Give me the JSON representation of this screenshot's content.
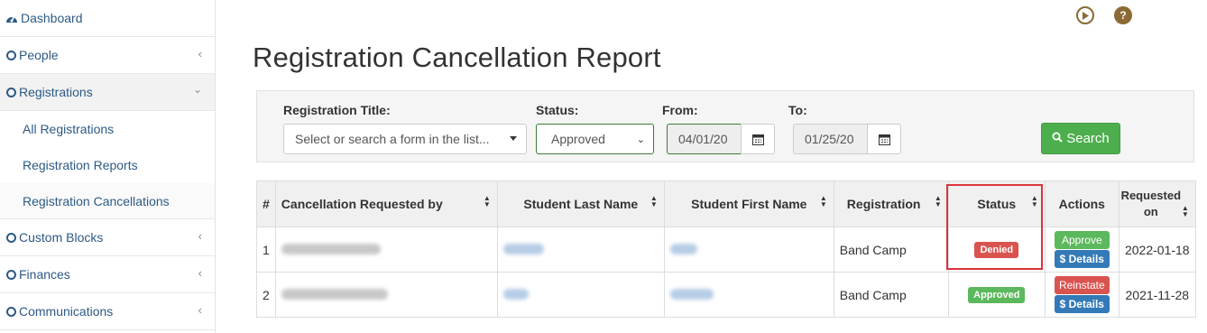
{
  "sidebar": {
    "items": [
      {
        "label": "Dashboard",
        "icon": "dashboard-icon"
      },
      {
        "label": "People",
        "icon": "circle-icon"
      },
      {
        "label": "Registrations",
        "icon": "circle-icon"
      },
      {
        "label": "Custom Blocks",
        "icon": "circle-icon"
      },
      {
        "label": "Finances",
        "icon": "circle-icon"
      },
      {
        "label": "Communications",
        "icon": "circle-icon"
      }
    ],
    "sub_items": [
      {
        "label": "All Registrations"
      },
      {
        "label": "Registration Reports"
      },
      {
        "label": "Registration Cancellations"
      }
    ]
  },
  "header": {
    "title": "Registration Cancellation Report",
    "help_glyph": "?"
  },
  "filters": {
    "title_label": "Registration Title:",
    "title_placeholder": "Select or search a form in the list...",
    "status_label": "Status:",
    "status_value": "Approved",
    "from_label": "From:",
    "from_value": "04/01/20",
    "to_label": "To:",
    "to_value": "01/25/20",
    "search_label": "Search"
  },
  "table": {
    "columns": [
      "#",
      "Cancellation Requested by",
      "Student Last Name",
      "Student First Name",
      "Registration",
      "Status",
      "Actions",
      "Requested on"
    ],
    "rows": [
      {
        "num": "1",
        "registration": "Band Camp",
        "status": "Denied",
        "action_primary": "Approve",
        "action_details": "$ Details",
        "requested_on": "2022-01-18"
      },
      {
        "num": "2",
        "registration": "Band Camp",
        "status": "Approved",
        "action_primary": "Reinstate",
        "action_details": "$ Details",
        "requested_on": "2021-11-28"
      }
    ]
  },
  "colors": {
    "accent": "#2c5a85",
    "success": "#5cb85c",
    "danger": "#d9534f",
    "primary": "#337ab7",
    "icon_brown": "#8b6a33"
  }
}
